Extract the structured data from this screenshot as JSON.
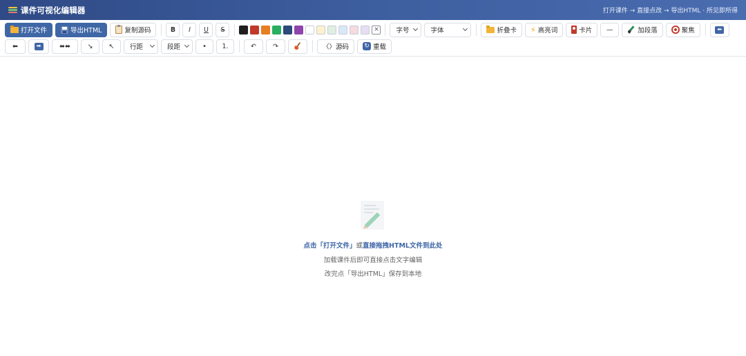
{
  "app": {
    "title": "课件可视化编辑器",
    "hint": "打开课件 → 直接点改 → 导出HTML · 所见即所得"
  },
  "toolbar": {
    "open_label": "打开文件",
    "export_label": "导出HTML",
    "copy_source_label": "复制源码",
    "bold_label": "B",
    "italic_label": "I",
    "underline_label": "U",
    "strike_label": "S",
    "colors": [
      "#1f1f1f",
      "#c0392b",
      "#e67e22",
      "#27ae60",
      "#2c4a7a",
      "#8e44ad",
      "#ffffff"
    ],
    "bg_colors": [
      "#fdf2cc",
      "#dff0e2",
      "#d8e8f8",
      "#f6dbe0",
      "#e6def2"
    ],
    "clear_color_label": "×",
    "font_size_label": "字号",
    "font_family_label": "字体",
    "fold_card_label": "折叠卡",
    "highlight_label": "高亮词",
    "card_label": "卡片",
    "divider_label": "—",
    "add_paragraph_label": "加段落",
    "focus_label": "聚焦",
    "back_icon_label": "⬅",
    "align_left_label": "⬅",
    "align_right_label": "➡",
    "align_center_label": "⬌⬌",
    "indent_label": "↘",
    "outdent_label": "↖",
    "line_spacing_label": "行距",
    "paragraph_spacing_label": "段距",
    "bullet_list_label": "•",
    "number_list_label": "1.",
    "undo_label": "↶",
    "redo_label": "↷",
    "source_label": "〈〉源码",
    "reload_label": "重载"
  },
  "empty_state": {
    "title_part1": "点击「打开文件」",
    "title_part2": "或",
    "title_part3": "直接拖拽HTML文件到此处",
    "line1": "加载课件后即可直接点击文字编辑",
    "line2": "改完点「导出HTML」保存到本地"
  }
}
